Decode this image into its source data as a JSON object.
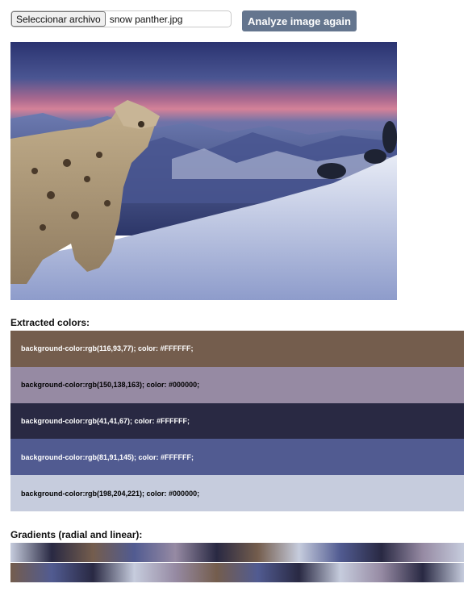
{
  "file_input": {
    "button_label": "Seleccionar archivo",
    "file_name": "snow panther.jpg"
  },
  "analyze_button": {
    "label": "Analyze image again"
  },
  "photo": {
    "description": "snow-leopard-on-mountain-ridge"
  },
  "extracted": {
    "title": "Extracted colors:",
    "swatches": [
      {
        "bg": "rgb(116,93,77)",
        "fg": "#FFFFFF",
        "label": "background-color:rgb(116,93,77); color: #FFFFFF;"
      },
      {
        "bg": "rgb(150,138,163)",
        "fg": "#000000",
        "label": "background-color:rgb(150,138,163); color: #000000;"
      },
      {
        "bg": "rgb(41,41,67)",
        "fg": "#FFFFFF",
        "label": "background-color:rgb(41,41,67); color: #FFFFFF;"
      },
      {
        "bg": "rgb(81,91,145)",
        "fg": "#FFFFFF",
        "label": "background-color:rgb(81,91,145); color: #FFFFFF;"
      },
      {
        "bg": "rgb(198,204,221)",
        "fg": "#000000",
        "label": "background-color:rgb(198,204,221); color: #000000;"
      }
    ]
  },
  "gradients": {
    "title": "Gradients (radial and linear):"
  },
  "colors": {
    "accent_button": "#64758e"
  }
}
